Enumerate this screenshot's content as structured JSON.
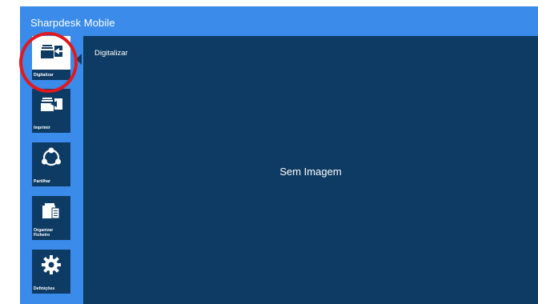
{
  "app": {
    "title": "Sharpdesk Mobile"
  },
  "sidebar": {
    "items": [
      {
        "label": "Digitalizar",
        "icon": "scan-icon",
        "active": true
      },
      {
        "label": "Imprimir",
        "icon": "print-icon",
        "active": false
      },
      {
        "label": "Partilhar",
        "icon": "share-icon",
        "active": false
      },
      {
        "label": "Organizar Ficheiro",
        "icon": "organize-file-icon",
        "active": false
      },
      {
        "label": "Definições",
        "icon": "gear-icon",
        "active": false
      }
    ]
  },
  "main": {
    "title": "Digitalizar",
    "empty_text": "Sem Imagem"
  },
  "colors": {
    "app_bg": "#3a8bea",
    "panel_bg": "#0e3b63",
    "highlight": "#e1191e"
  }
}
